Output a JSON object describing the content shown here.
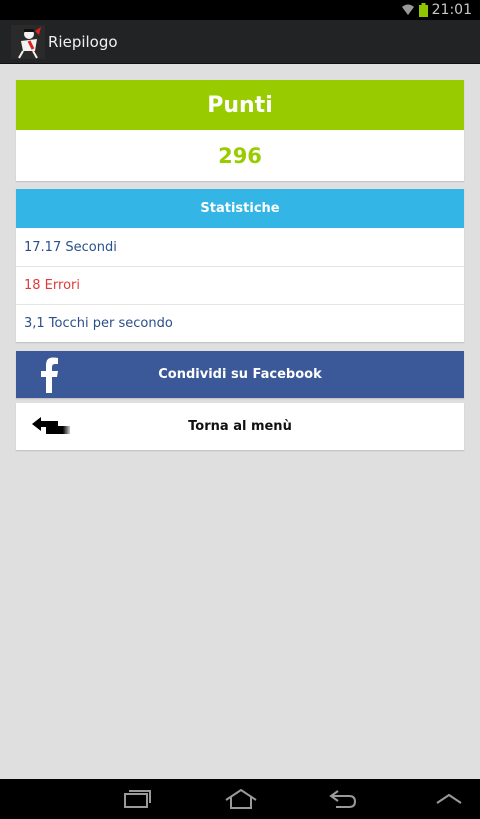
{
  "status_bar": {
    "clock": "21:01",
    "icons": [
      "wifi-icon",
      "battery-icon"
    ]
  },
  "action_bar": {
    "title": "Riepilogo",
    "app_icon": "app-logo-icon"
  },
  "score": {
    "label": "Punti",
    "value": "296"
  },
  "stats": {
    "title": "Statistiche",
    "rows": [
      {
        "text": "17.17 Secondi",
        "color": "#2b4f8a"
      },
      {
        "text": "18 Errori",
        "color": "#e03b3b"
      },
      {
        "text": "3,1 Tocchi per secondo",
        "color": "#2b4f8a"
      }
    ]
  },
  "actions": {
    "facebook_label": "Condividi su Facebook",
    "back_label": "Torna al menù"
  },
  "nav_bar": {
    "buttons": [
      "recent-apps-icon",
      "home-icon",
      "back-icon",
      "menu-up-icon"
    ]
  },
  "colors": {
    "green": "#99cc00",
    "blue": "#33b5e5",
    "facebook": "#3b5998"
  }
}
